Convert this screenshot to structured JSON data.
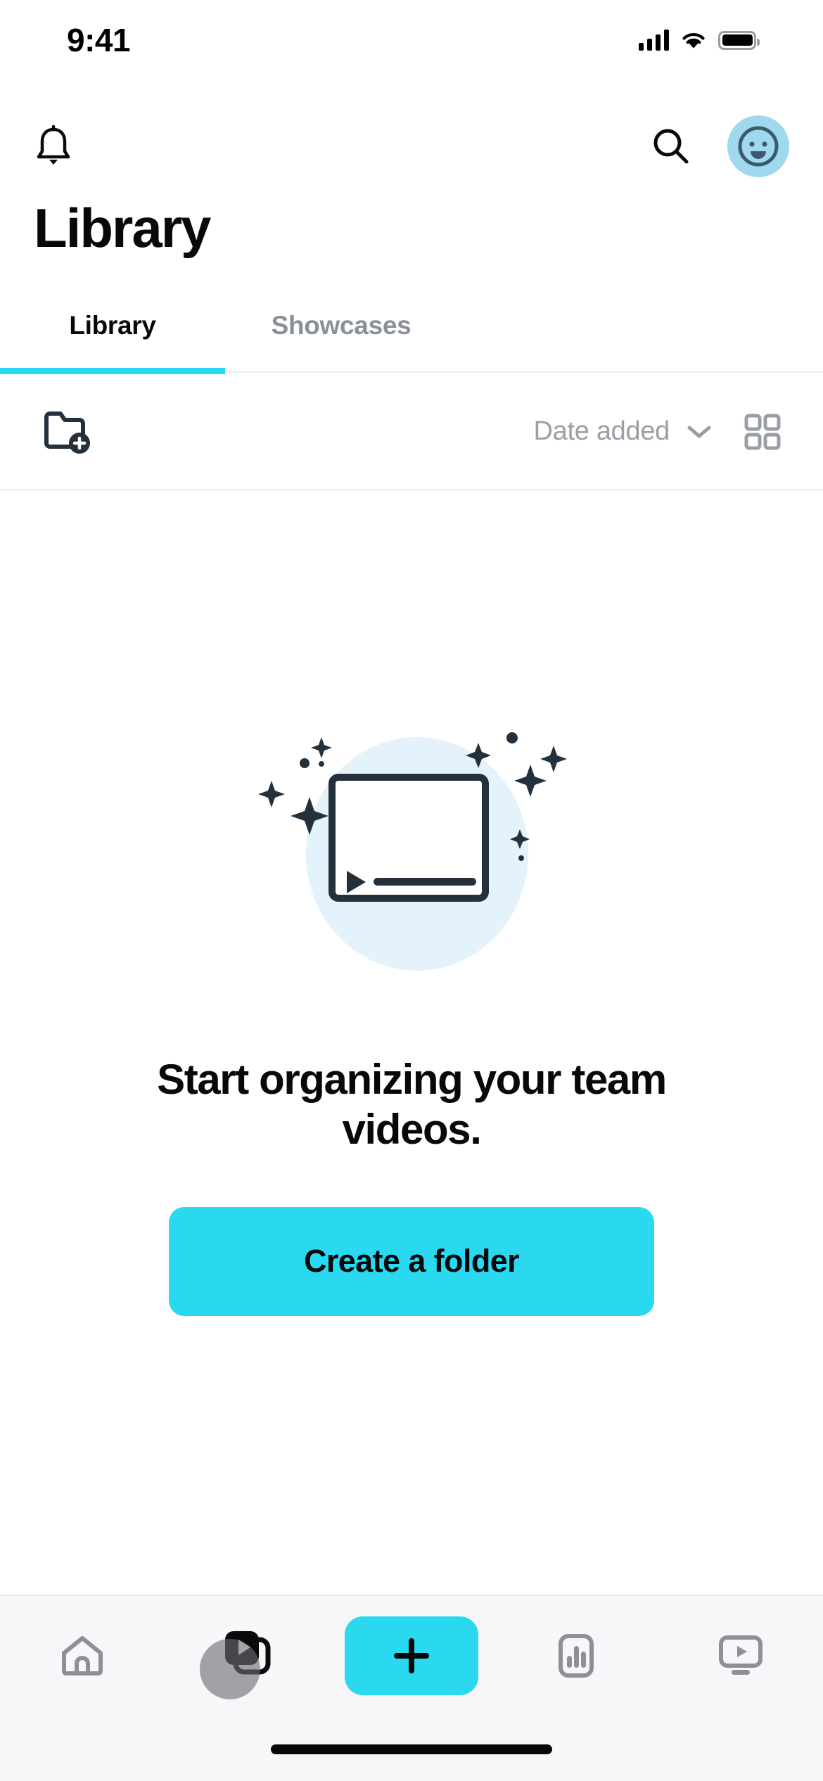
{
  "status_bar": {
    "time": "9:41",
    "cellular_icon": "cellular-signal-icon",
    "wifi_icon": "wifi-icon",
    "battery_icon": "battery-full-icon"
  },
  "app_bar": {
    "notifications_icon": "bell-icon",
    "search_icon": "search-icon",
    "avatar_icon": "user-avatar-smiley-icon"
  },
  "header": {
    "title": "Library"
  },
  "tabs": [
    {
      "label": "Library",
      "active": true
    },
    {
      "label": "Showcases",
      "active": false
    }
  ],
  "toolbar": {
    "new_folder_icon": "folder-add-icon",
    "sort_label": "Date added",
    "sort_chevron_icon": "chevron-down-icon",
    "grid_view_icon": "grid-view-icon"
  },
  "empty_state": {
    "illustration_icon": "empty-video-sparkles-illustration",
    "title": "Start organizing your team videos.",
    "cta_label": "Create a folder"
  },
  "bottom_nav": [
    {
      "label": "Home",
      "icon": "home-icon",
      "active": false
    },
    {
      "label": "Library",
      "icon": "video-library-icon",
      "active": true
    },
    {
      "label": "Create",
      "icon": "plus-icon",
      "active": false
    },
    {
      "label": "Analytics",
      "icon": "bar-chart-icon",
      "active": false
    },
    {
      "label": "Showcase",
      "icon": "monitor-play-icon",
      "active": false
    }
  ],
  "colors": {
    "accent_cyan": "#2ad9f0",
    "text_primary": "#06080a",
    "text_muted": "#9a9ea6",
    "illustration_bg": "#e4f2fb",
    "illustration_ink": "#24313c",
    "avatar_bg": "#9ed9ef",
    "nav_bg": "#f7f7f9"
  }
}
